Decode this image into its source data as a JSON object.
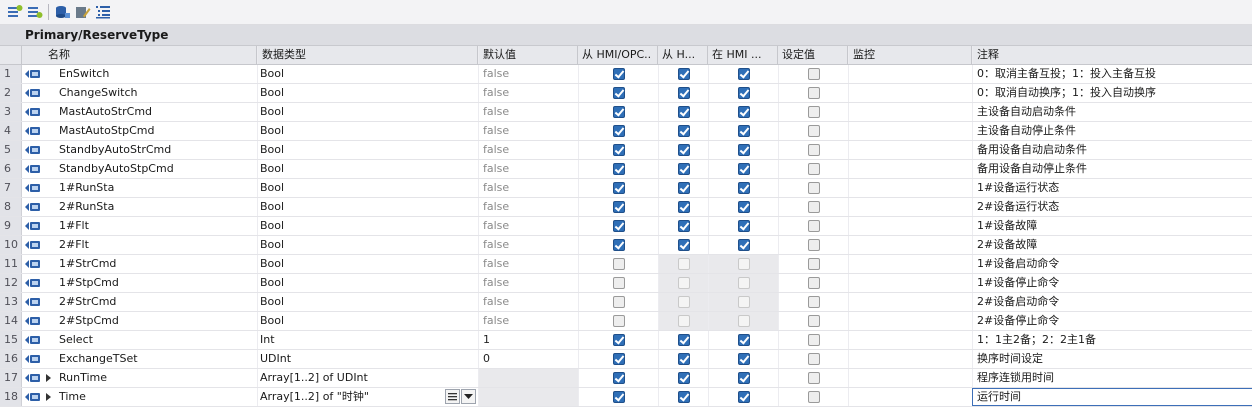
{
  "title": "Primary/ReserveType",
  "toolbar": [
    {
      "icon": "insert-row-icon"
    },
    {
      "icon": "add-row-icon"
    },
    {
      "icon": "bind-db-icon"
    },
    {
      "icon": "edit-icon"
    },
    {
      "icon": "list-view-icon"
    }
  ],
  "headers": {
    "name": "名称",
    "type": "数据类型",
    "default": "默认值",
    "hmi1": "从 HMI/OPC..",
    "hmi2": "从 H...",
    "hmi3": "在 HMI ...",
    "setpoint": "设定值",
    "monitor": "监控",
    "comment": "注释"
  },
  "rows": [
    {
      "num": "1",
      "name": "EnSwitch",
      "type": "Bool",
      "def": "false",
      "h1": "on",
      "h2": "on",
      "h3": "on",
      "set": "off",
      "cmt": "0：取消主备互投；1：投入主备互投"
    },
    {
      "num": "2",
      "name": "ChangeSwitch",
      "type": "Bool",
      "def": "false",
      "h1": "on",
      "h2": "on",
      "h3": "on",
      "set": "off",
      "cmt": "0：取消自动换序；1：投入自动换序"
    },
    {
      "num": "3",
      "name": "MastAutoStrCmd",
      "type": "Bool",
      "def": "false",
      "h1": "on",
      "h2": "on",
      "h3": "on",
      "set": "off",
      "cmt": "主设备自动启动条件"
    },
    {
      "num": "4",
      "name": "MastAutoStpCmd",
      "type": "Bool",
      "def": "false",
      "h1": "on",
      "h2": "on",
      "h3": "on",
      "set": "off",
      "cmt": "主设备自动停止条件"
    },
    {
      "num": "5",
      "name": "StandbyAutoStrCmd",
      "type": "Bool",
      "def": "false",
      "h1": "on",
      "h2": "on",
      "h3": "on",
      "set": "off",
      "cmt": "备用设备自动启动条件"
    },
    {
      "num": "6",
      "name": "StandbyAutoStpCmd",
      "type": "Bool",
      "def": "false",
      "h1": "on",
      "h2": "on",
      "h3": "on",
      "set": "off",
      "cmt": "备用设备自动停止条件"
    },
    {
      "num": "7",
      "name": "1#RunSta",
      "type": "Bool",
      "def": "false",
      "h1": "on",
      "h2": "on",
      "h3": "on",
      "set": "off",
      "cmt": "1#设备运行状态"
    },
    {
      "num": "8",
      "name": "2#RunSta",
      "type": "Bool",
      "def": "false",
      "h1": "on",
      "h2": "on",
      "h3": "on",
      "set": "off",
      "cmt": "2#设备运行状态"
    },
    {
      "num": "9",
      "name": "1#Flt",
      "type": "Bool",
      "def": "false",
      "h1": "on",
      "h2": "on",
      "h3": "on",
      "set": "off",
      "cmt": "1#设备故障"
    },
    {
      "num": "10",
      "name": "2#Flt",
      "type": "Bool",
      "def": "false",
      "h1": "on",
      "h2": "on",
      "h3": "on",
      "set": "off",
      "cmt": "2#设备故障"
    },
    {
      "num": "11",
      "name": "1#StrCmd",
      "type": "Bool",
      "def": "false",
      "h1": "off",
      "h2": "dis",
      "h3": "dis",
      "set": "off",
      "cmt": "1#设备启动命令"
    },
    {
      "num": "12",
      "name": "1#StpCmd",
      "type": "Bool",
      "def": "false",
      "h1": "off",
      "h2": "dis",
      "h3": "dis",
      "set": "off",
      "cmt": "1#设备停止命令"
    },
    {
      "num": "13",
      "name": "2#StrCmd",
      "type": "Bool",
      "def": "false",
      "h1": "off",
      "h2": "dis",
      "h3": "dis",
      "set": "off",
      "cmt": "2#设备启动命令"
    },
    {
      "num": "14",
      "name": "2#StpCmd",
      "type": "Bool",
      "def": "false",
      "h1": "off",
      "h2": "dis",
      "h3": "dis",
      "set": "off",
      "cmt": "2#设备停止命令"
    },
    {
      "num": "15",
      "name": "Select",
      "type": "Int",
      "def": "1",
      "h1": "on",
      "h2": "on",
      "h3": "on",
      "set": "off",
      "cmt": "1：1主2备；2：2主1备"
    },
    {
      "num": "16",
      "name": "ExchangeTSet",
      "type": "UDInt",
      "def": "0",
      "h1": "on",
      "h2": "on",
      "h3": "on",
      "set": "off",
      "cmt": "换序时间设定"
    },
    {
      "num": "17",
      "name": "RunTime",
      "type": "Array[1..2] of UDInt",
      "def": "",
      "h1": "on",
      "h2": "on",
      "h3": "on",
      "set": "off",
      "cmt": "程序连锁用时间"
    },
    {
      "num": "18",
      "name": "Time",
      "type": "Array[1..2] of \"时钟\"",
      "def": "",
      "h1": "on",
      "h2": "on",
      "h3": "on",
      "set": "off",
      "cmt": "运行时间"
    }
  ]
}
